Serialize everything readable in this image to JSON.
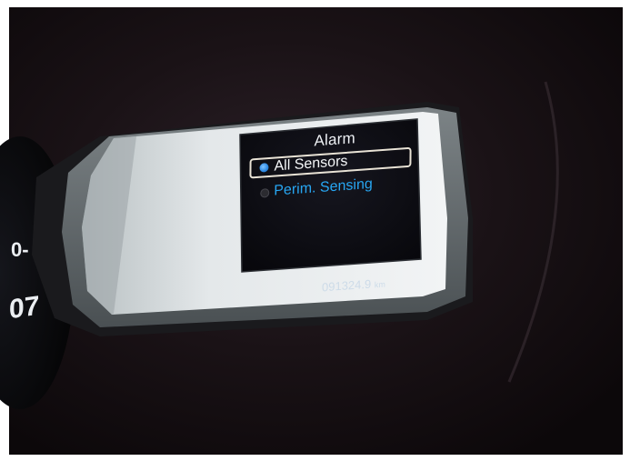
{
  "display": {
    "title": "Alarm",
    "options": [
      {
        "label": "All Sensors",
        "selected": true
      },
      {
        "label": "Perim. Sensing",
        "selected": false
      }
    ],
    "odometer": {
      "value": "091324.9",
      "unit": "km"
    }
  },
  "gauge": {
    "partial_digits": [
      "0-",
      "07"
    ]
  },
  "colors": {
    "selection_highlight": "#27a6f2",
    "screen_background": "#0c0c14",
    "bezel_light": "#dfe3e6"
  }
}
